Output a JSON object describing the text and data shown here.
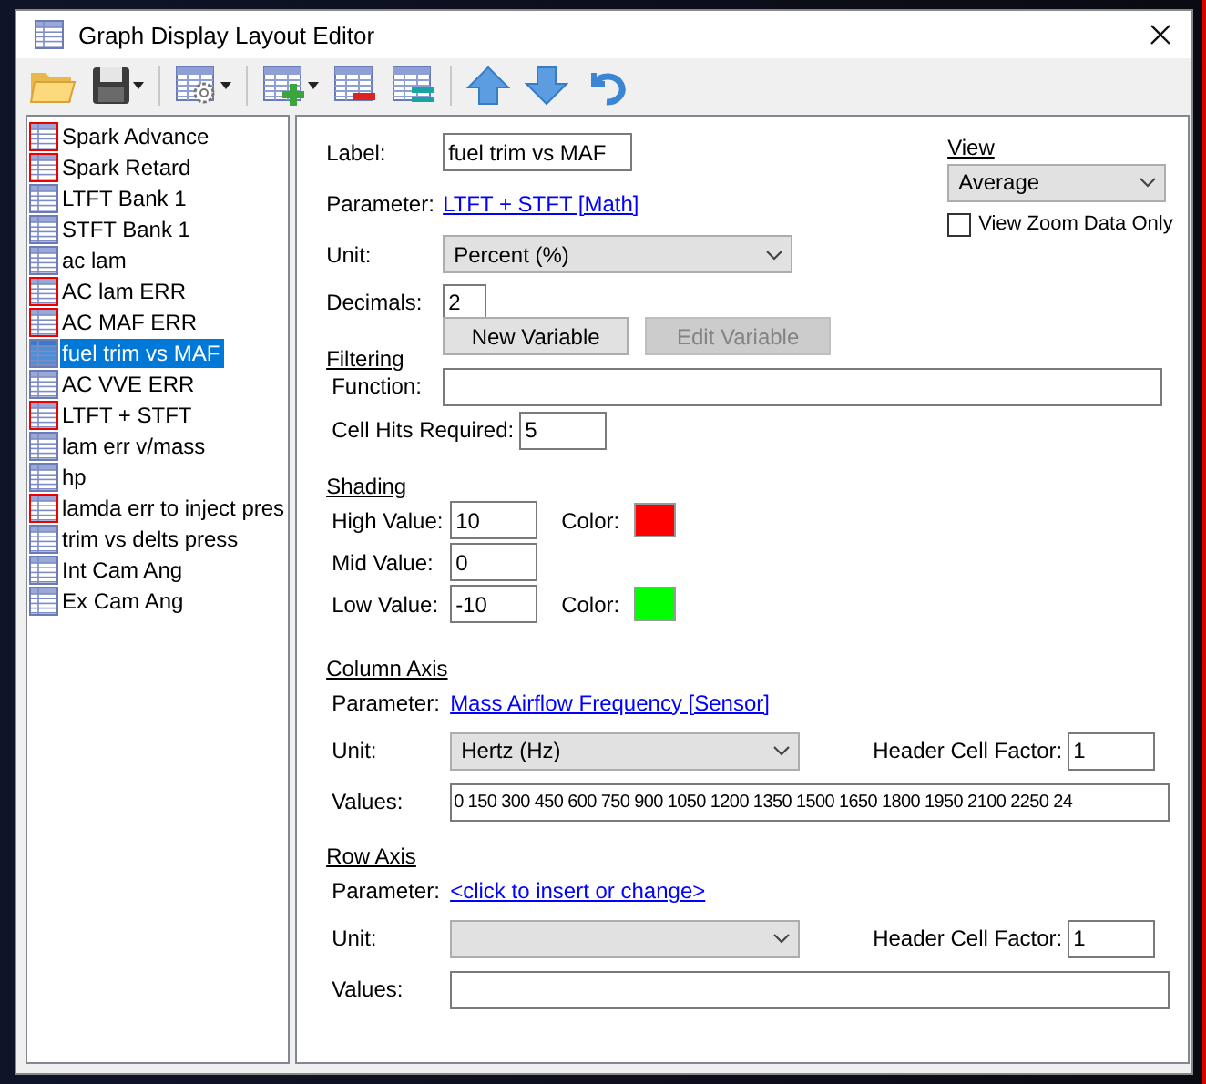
{
  "window": {
    "title": "Graph Display Layout Editor"
  },
  "toolbar": [
    {
      "kind": "open"
    },
    {
      "kind": "save",
      "caret": true
    },
    {
      "kind": "separator"
    },
    {
      "kind": "settings",
      "caret": true
    },
    {
      "kind": "separator"
    },
    {
      "kind": "add",
      "caret": true
    },
    {
      "kind": "remove"
    },
    {
      "kind": "equal"
    },
    {
      "kind": "separator"
    },
    {
      "kind": "up"
    },
    {
      "kind": "down"
    },
    {
      "kind": "undo"
    }
  ],
  "layouts": [
    {
      "label": "Spark Advance",
      "marked": true,
      "selected": false
    },
    {
      "label": "Spark Retard",
      "marked": true,
      "selected": false
    },
    {
      "label": "LTFT Bank 1",
      "marked": false,
      "selected": false
    },
    {
      "label": "STFT Bank 1",
      "marked": false,
      "selected": false
    },
    {
      "label": "ac lam",
      "marked": false,
      "selected": false
    },
    {
      "label": "AC lam ERR",
      "marked": true,
      "selected": false
    },
    {
      "label": "AC MAF ERR",
      "marked": true,
      "selected": false
    },
    {
      "label": "fuel trim vs MAF",
      "marked": false,
      "selected": true
    },
    {
      "label": "AC VVE ERR",
      "marked": false,
      "selected": false
    },
    {
      "label": "LTFT + STFT",
      "marked": true,
      "selected": false
    },
    {
      "label": "lam err v/mass",
      "marked": false,
      "selected": false
    },
    {
      "label": "hp",
      "marked": false,
      "selected": false
    },
    {
      "label": "lamda err to inject pres",
      "marked": true,
      "selected": false
    },
    {
      "label": "trim vs delts press",
      "marked": false,
      "selected": false
    },
    {
      "label": "Int Cam Ang",
      "marked": false,
      "selected": false
    },
    {
      "label": "Ex Cam Ang",
      "marked": false,
      "selected": false
    }
  ],
  "general": {
    "label": {
      "caption": "Label:",
      "value": "fuel trim vs MAF"
    },
    "parameter": {
      "caption": "Parameter:",
      "link": "LTFT + STFT [Math]"
    },
    "unit": {
      "caption": "Unit:",
      "value": "Percent (%)"
    },
    "decimals": {
      "caption": "Decimals:",
      "value": "2"
    }
  },
  "view": {
    "heading": "View",
    "value": "Average",
    "zoom_only": {
      "label": "View Zoom Data Only",
      "checked": false
    }
  },
  "buttons": [
    {
      "label": "New Variable",
      "disabled": false
    },
    {
      "label": "Edit Variable",
      "disabled": true
    }
  ],
  "filtering": {
    "heading": "Filtering",
    "function": {
      "caption": "Function:"
    },
    "cell_hits": {
      "caption": "Cell Hits Required:",
      "value": "5"
    }
  },
  "shading": {
    "heading": "Shading",
    "rows": [
      {
        "caption": "High Value:",
        "value": "10",
        "color_caption": "Color:",
        "color": "#ff0000"
      },
      {
        "caption": "Mid Value:",
        "value": "0"
      },
      {
        "caption": "Low Value:",
        "value": "-10",
        "color_caption": "Color:",
        "color": "#00ff00"
      }
    ]
  },
  "column_axis": {
    "heading": "Column Axis",
    "parameter": {
      "caption": "Parameter:",
      "link": "Mass Airflow Frequency [Sensor]"
    },
    "unit": {
      "caption": "Unit:",
      "value": "Hertz (Hz)"
    },
    "factor": {
      "caption": "Header Cell Factor:",
      "value": "1"
    },
    "values": {
      "caption": "Values:",
      "value": "0 150 300 450 600 750 900 1050 1200 1350 1500 1650 1800 1950 2100 2250 24"
    }
  },
  "row_axis": {
    "heading": "Row Axis",
    "parameter": {
      "caption": "Parameter:",
      "link": "<click to insert or change>"
    },
    "unit": {
      "caption": "Unit:"
    },
    "factor": {
      "caption": "Header Cell Factor:",
      "value": "1"
    },
    "values": {
      "caption": "Values:"
    }
  }
}
